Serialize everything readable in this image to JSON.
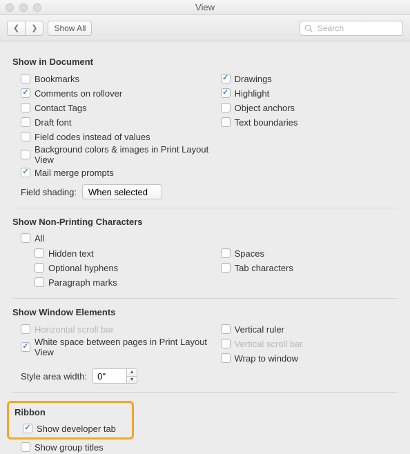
{
  "window": {
    "title": "View"
  },
  "toolbar": {
    "show_all": "Show All",
    "search_placeholder": "Search"
  },
  "sections": {
    "show_in_document": {
      "title": "Show in Document",
      "left": [
        {
          "label": "Bookmarks",
          "checked": false
        },
        {
          "label": "Comments on rollover",
          "checked": true
        },
        {
          "label": "Contact Tags",
          "checked": false
        },
        {
          "label": "Draft font",
          "checked": false
        },
        {
          "label": "Field codes instead of values",
          "checked": false
        },
        {
          "label": "Background colors & images in Print Layout View",
          "checked": false
        },
        {
          "label": "Mail merge prompts",
          "checked": true
        }
      ],
      "right": [
        {
          "label": "Drawings",
          "checked": true
        },
        {
          "label": "Highlight",
          "checked": true
        },
        {
          "label": "Object anchors",
          "checked": false
        },
        {
          "label": "Text boundaries",
          "checked": false
        }
      ],
      "field_shading_label": "Field shading:",
      "field_shading_value": "When selected"
    },
    "non_printing": {
      "title": "Show Non-Printing Characters",
      "all": {
        "label": "All",
        "checked": false
      },
      "left": [
        {
          "label": "Hidden text",
          "checked": false
        },
        {
          "label": "Optional hyphens",
          "checked": false
        },
        {
          "label": "Paragraph marks",
          "checked": false
        }
      ],
      "right": [
        {
          "label": "Spaces",
          "checked": false
        },
        {
          "label": "Tab characters",
          "checked": false
        }
      ]
    },
    "window_elements": {
      "title": "Show Window Elements",
      "left": [
        {
          "label": "Horizontal scroll bar",
          "checked": false,
          "disabled": true
        },
        {
          "label": "White space between pages in Print Layout View",
          "checked": true
        }
      ],
      "right": [
        {
          "label": "Vertical ruler",
          "checked": false
        },
        {
          "label": "Vertical scroll bar",
          "checked": false,
          "disabled": true
        },
        {
          "label": "Wrap to window",
          "checked": false
        }
      ],
      "style_area_label": "Style area width:",
      "style_area_value": "0\""
    },
    "ribbon": {
      "title": "Ribbon",
      "items": [
        {
          "label": "Show developer tab",
          "checked": true
        },
        {
          "label": "Show group titles",
          "checked": false
        }
      ]
    }
  }
}
